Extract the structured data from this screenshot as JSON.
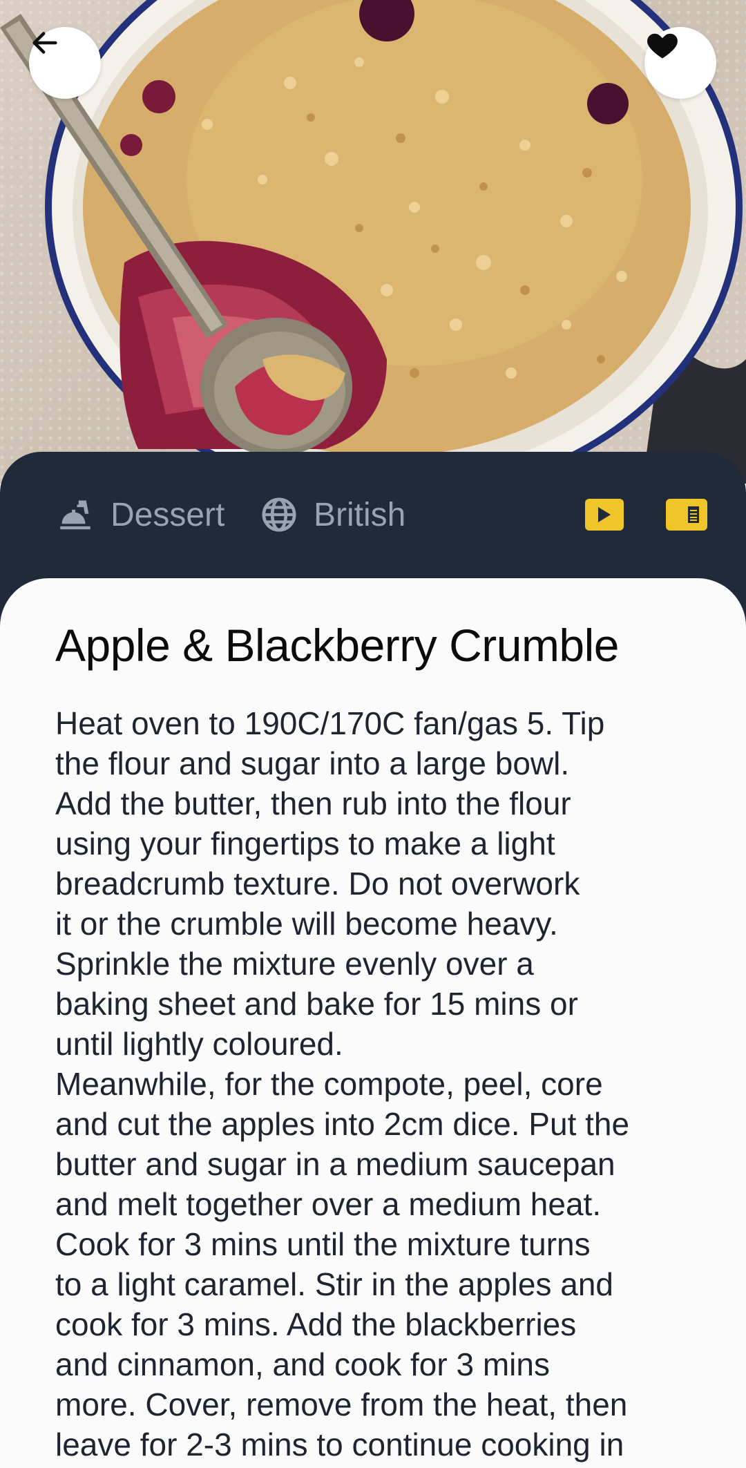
{
  "meal": {
    "title": "Apple & Blackberry Crumble",
    "category": "Dessert",
    "area": "British",
    "instructions": "Heat oven to 190C/170C fan/gas 5. Tip\nthe flour and sugar into a large bowl.\nAdd the butter, then rub into the flour\nusing your fingertips to make a light\nbreadcrumb texture. Do not overwork\nit or the crumble will become heavy.\nSprinkle the mixture evenly over a\nbaking sheet and bake for 15 mins or\nuntil lightly coloured.\nMeanwhile, for the compote, peel, core\nand cut the apples into 2cm dice. Put the\nbutter and sugar in a medium saucepan\nand melt together over a medium heat.\nCook for 3 mins until the mixture turns\nto a light caramel. Stir in the apples and\ncook for 3 mins. Add the blackberries\nand cinnamon, and cook for 3 mins\nmore. Cover, remove from the heat, then\nleave for 2-3 mins to continue cooking in"
  },
  "icons": {
    "back": "arrow-left-icon",
    "favorite": "heart-icon",
    "category": "food-service-icon",
    "area": "globe-icon",
    "video": "play-icon",
    "source": "article-icon"
  },
  "colors": {
    "info_bar": "#212a3a",
    "meta_text": "#9aa3b0",
    "accent": "#f0c52a",
    "sheet": "#fbfbfb",
    "title": "#0b0b0b"
  }
}
